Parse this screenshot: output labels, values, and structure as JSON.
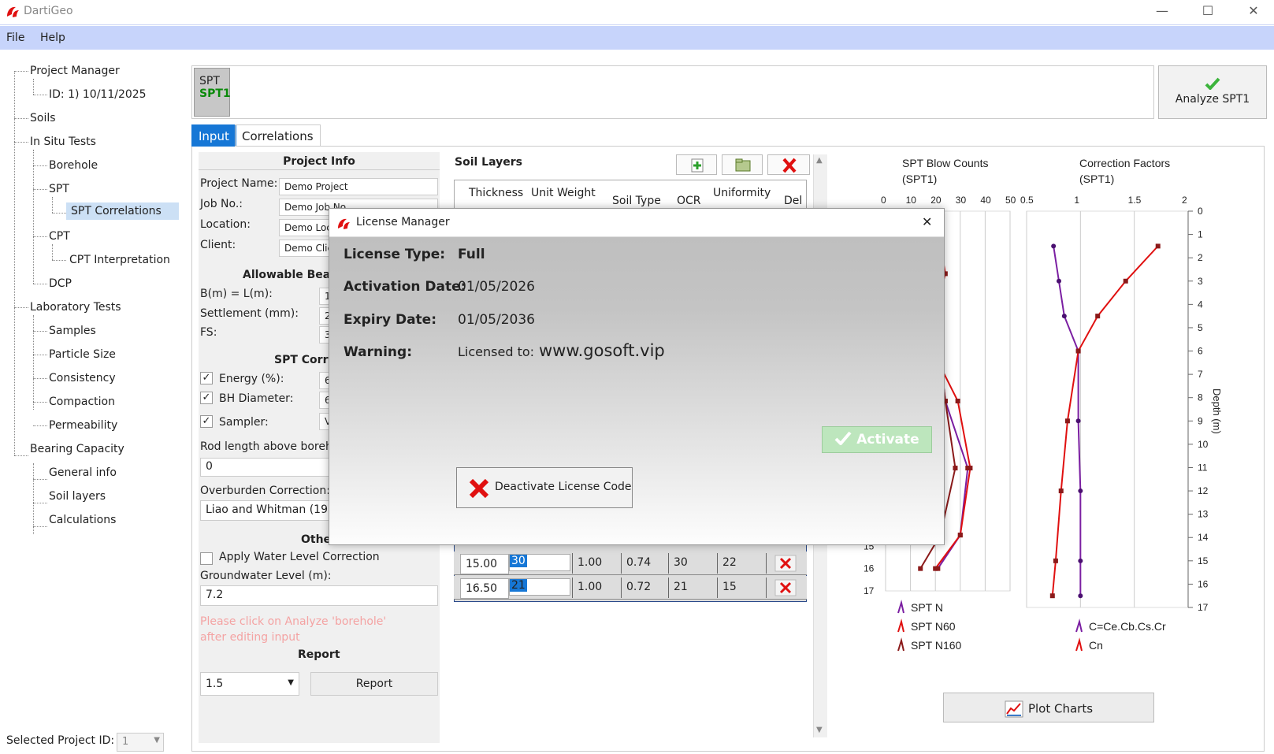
{
  "window": {
    "title": "DartiGeo",
    "minimize": "—",
    "maximize": "☐",
    "close": "✕"
  },
  "menu": {
    "file": "File",
    "help": "Help"
  },
  "tree": {
    "project_manager": "Project Manager",
    "project_id": "ID: 1) 10/11/2025",
    "soils": "Soils",
    "in_situ": "In Situ Tests",
    "borehole": "Borehole",
    "spt": "SPT",
    "spt_correlations": "SPT Correlations",
    "cpt": "CPT",
    "cpt_interp": "CPT Interpretation",
    "dcp": "DCP",
    "lab_tests": "Laboratory Tests",
    "samples": "Samples",
    "particle_size": "Particle Size",
    "consistency": "Consistency",
    "compaction": "Compaction",
    "permeability": "Permeability",
    "bearing": "Bearing Capacity",
    "general_info": "General info",
    "soil_layers": "Soil layers",
    "calculations": "Calculations"
  },
  "footer": {
    "selected_label": "Selected Project ID:",
    "selected_value": "1"
  },
  "header": {
    "badge_line1": "SPT",
    "badge_line2": "SPT1",
    "analyze_label": "Analyze SPT1"
  },
  "tabs": {
    "input": "Input",
    "correlations": "Correlations"
  },
  "input": {
    "project_info": "Project Info",
    "project_name_label": "Project Name:",
    "project_name": "Demo Project",
    "job_label": "Job No.:",
    "job": "Demo Job No",
    "location_label": "Location:",
    "location": "Demo Loca",
    "client_label": "Client:",
    "client": "Demo Clie",
    "bearing_hdr": "Allowable Beari",
    "b_label": "B(m) = L(m):",
    "b_val": "1",
    "settle_label": "Settlement (mm):",
    "settle_val": "2",
    "fs_label": "FS:",
    "fs_val": "3",
    "spt_corr_hdr": "SPT Corre",
    "energy_label": "Energy (%):",
    "energy_val": "6",
    "bh_label": "BH Diameter:",
    "bh_val": "6",
    "sampler_label": "Sampler:",
    "sampler_val": "V",
    "check_mark": "✓",
    "rod_label": "Rod length above boreho",
    "rod_val": "0",
    "overburden_label": "Overburden Correction:",
    "overburden_val": "Liao and Whitman (1986",
    "other_hdr": "Othe",
    "water_label": "Apply Water Level Correction",
    "gw_label": "Groundwater Level (m):",
    "gw_val": "7.2",
    "warning": "Please click on Analyze 'borehole' after editing input",
    "report_hdr": "Report",
    "report_val": "1.5",
    "report_btn": "Report"
  },
  "soil_layers": {
    "title": "Soil Layers",
    "columns": [
      "Thickness",
      "Unit Weight",
      "Soil Type",
      "OCR",
      "Uniformity",
      "Del"
    ],
    "rows": [
      {
        "depth": "15.00",
        "n": "30",
        "c1": "1.00",
        "c2": "0.74",
        "c3": "30",
        "c4": "22"
      },
      {
        "depth": "16.50",
        "n": "21",
        "c1": "1.00",
        "c2": "0.72",
        "c3": "21",
        "c4": "15"
      }
    ]
  },
  "dialog": {
    "title": "License Manager",
    "close": "✕",
    "type_label": "License Type:",
    "type_val": "Full",
    "act_label": "Activation Date:",
    "act_val": "01/05/2026",
    "exp_label": "Expiry Date:",
    "exp_val": "01/05/2036",
    "warn_label": "Warning:",
    "warn_prefix": "Licensed to:",
    "warn_url": "www.gosoft.vip",
    "activate": "Activate",
    "deactivate": "Deactivate License Code"
  },
  "charts": {
    "plot_btn": "Plot Charts",
    "colors": {
      "n": "#7b1fa2",
      "n60": "#e01010",
      "n160": "#8b1a1a",
      "c": "#7b1fa2",
      "cn": "#e01010"
    }
  },
  "chart_data": [
    {
      "type": "line",
      "title": "SPT Blow Counts",
      "subtitle": "(SPT1)",
      "x_ticks": [
        "0",
        "10",
        "20",
        "30",
        "40",
        "50"
      ],
      "xlim": [
        0,
        50
      ],
      "ylim": [
        0,
        17
      ],
      "y_ticks_visible": [
        "15",
        "16",
        "17"
      ],
      "series": [
        {
          "name": "SPT N",
          "points": [
            [
              20,
              3
            ],
            [
              20,
              4.5
            ],
            [
              24,
              8.5
            ],
            [
              33,
              11.5
            ],
            [
              30,
              14.5
            ],
            [
              21,
              16
            ]
          ]
        },
        {
          "name": "SPT N60",
          "points": [
            [
              22,
              1.5
            ],
            [
              24,
              2.8
            ],
            [
              20,
              4.5
            ],
            [
              20,
              6.5
            ],
            [
              29,
              8.5
            ],
            [
              34,
              11.5
            ],
            [
              30,
              14.5
            ],
            [
              20,
              16
            ]
          ]
        },
        {
          "name": "SPT N160",
          "points": [
            [
              22,
              2.8
            ],
            [
              22,
              6.5
            ],
            [
              24,
              8.5
            ],
            [
              28,
              11.5
            ],
            [
              22,
              14.5
            ],
            [
              14,
              16
            ]
          ]
        }
      ]
    },
    {
      "type": "line",
      "title": "Correction Factors",
      "subtitle": "(SPT1)",
      "x_ticks": [
        "0.5",
        "1",
        "1.5",
        "2"
      ],
      "xlim": [
        0.5,
        2
      ],
      "ylim": [
        0,
        17
      ],
      "y_ticks": [
        "0",
        "1",
        "2",
        "3",
        "4",
        "5",
        "6",
        "7",
        "8",
        "9",
        "10",
        "11",
        "12",
        "13",
        "14",
        "15",
        "16",
        "17"
      ],
      "ylabel": "Depth (m)",
      "series": [
        {
          "name": "C=Ce.Cb.Cs.Cr",
          "points": [
            [
              0.75,
              1.5
            ],
            [
              0.8,
              3
            ],
            [
              0.85,
              4.5
            ],
            [
              0.98,
              6
            ],
            [
              0.98,
              9
            ],
            [
              1,
              12
            ],
            [
              1,
              15
            ],
            [
              1,
              16.5
            ]
          ]
        },
        {
          "name": "Cn",
          "points": [
            [
              1.72,
              1.5
            ],
            [
              1.42,
              3
            ],
            [
              1.16,
              4.5
            ],
            [
              0.98,
              6
            ],
            [
              0.88,
              9
            ],
            [
              0.82,
              12
            ],
            [
              0.77,
              15
            ],
            [
              0.74,
              16.5
            ]
          ]
        }
      ]
    }
  ]
}
